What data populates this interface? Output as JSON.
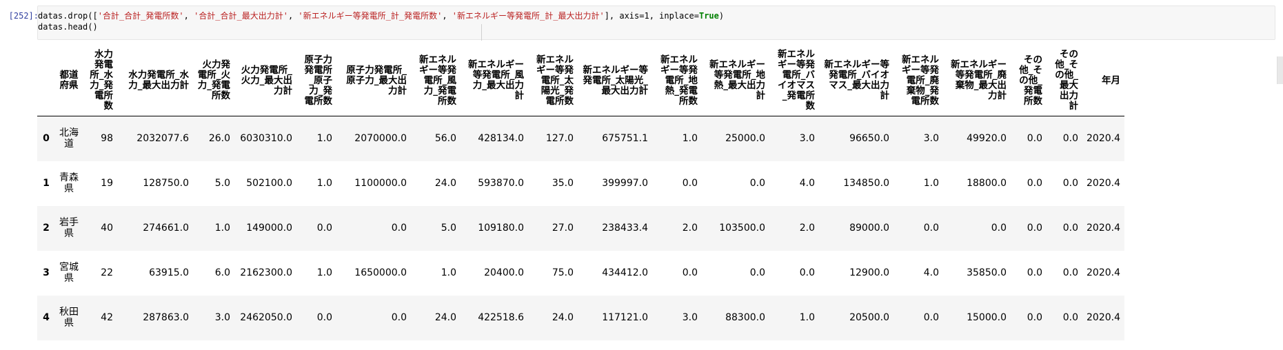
{
  "cell": {
    "prompt": "[252]:",
    "code": {
      "line1_prefix": "datas.drop([",
      "strings": [
        "'合計_合計_発電所数'",
        "'合計_合計_最大出力計'",
        "'新エネルギー等発電所_計_発電所数'",
        "'新エネルギー等発電所_計_最大出力計'"
      ],
      "sep": ", ",
      "line1_mid": "], axis=1, inplace=",
      "keyword": "True",
      "line1_end": ")",
      "line2": "datas.head()"
    }
  },
  "table": {
    "columns": [
      "都道府県",
      "水力発電所_水力_発電所数",
      "水力発電所_水力_最大出力計",
      "火力発電所_火力_発電所数",
      "火力発電所_火力_最大出力計",
      "原子力発電所_原子力_発電所数",
      "原子力発電所_原子力_最大出力計",
      "新エネルギー等発電所_風力_発電所数",
      "新エネルギー等発電所_風力_最大出力計",
      "新エネルギー等発電所_太陽光_発電所数",
      "新エネルギー等発電所_太陽光_最大出力計",
      "新エネルギー等発電所_地熱_発電所数",
      "新エネルギー等発電所_地熱_最大出力計",
      "新エネルギー等発電所_バイオマス_発電所数",
      "新エネルギー等発電所_バイオマス_最大出力計",
      "新エネルギー等発電所_廃棄物_発電所数",
      "新エネルギー等発電所_廃棄物_最大出力計",
      "その他_その他_発電所数",
      "その他_その他_最大出力計",
      "年月"
    ],
    "rows": [
      {
        "index": "0",
        "values": [
          "北海道",
          "98",
          "2032077.6",
          "26.0",
          "6030310.0",
          "1.0",
          "2070000.0",
          "56.0",
          "428134.0",
          "127.0",
          "675751.1",
          "1.0",
          "25000.0",
          "3.0",
          "96650.0",
          "3.0",
          "49920.0",
          "0.0",
          "0.0",
          "2020.4"
        ]
      },
      {
        "index": "1",
        "values": [
          "青森県",
          "19",
          "128750.0",
          "5.0",
          "502100.0",
          "1.0",
          "1100000.0",
          "24.0",
          "593870.0",
          "35.0",
          "399997.0",
          "0.0",
          "0.0",
          "4.0",
          "134850.0",
          "1.0",
          "18800.0",
          "0.0",
          "0.0",
          "2020.4"
        ]
      },
      {
        "index": "2",
        "values": [
          "岩手県",
          "40",
          "274661.0",
          "1.0",
          "149000.0",
          "0.0",
          "0.0",
          "5.0",
          "109180.0",
          "27.0",
          "238433.4",
          "2.0",
          "103500.0",
          "2.0",
          "89000.0",
          "0.0",
          "0.0",
          "0.0",
          "0.0",
          "2020.4"
        ]
      },
      {
        "index": "3",
        "values": [
          "宮城県",
          "22",
          "63915.0",
          "6.0",
          "2162300.0",
          "1.0",
          "1650000.0",
          "1.0",
          "20400.0",
          "75.0",
          "434412.0",
          "0.0",
          "0.0",
          "0.0",
          "12900.0",
          "4.0",
          "35850.0",
          "0.0",
          "0.0",
          "2020.4"
        ]
      },
      {
        "index": "4",
        "values": [
          "秋田県",
          "42",
          "287863.0",
          "3.0",
          "2462050.0",
          "0.0",
          "0.0",
          "24.0",
          "422518.6",
          "24.0",
          "117121.0",
          "3.0",
          "88300.0",
          "1.0",
          "20500.0",
          "0.0",
          "15000.0",
          "0.0",
          "0.0",
          "2020.4"
        ]
      }
    ]
  }
}
